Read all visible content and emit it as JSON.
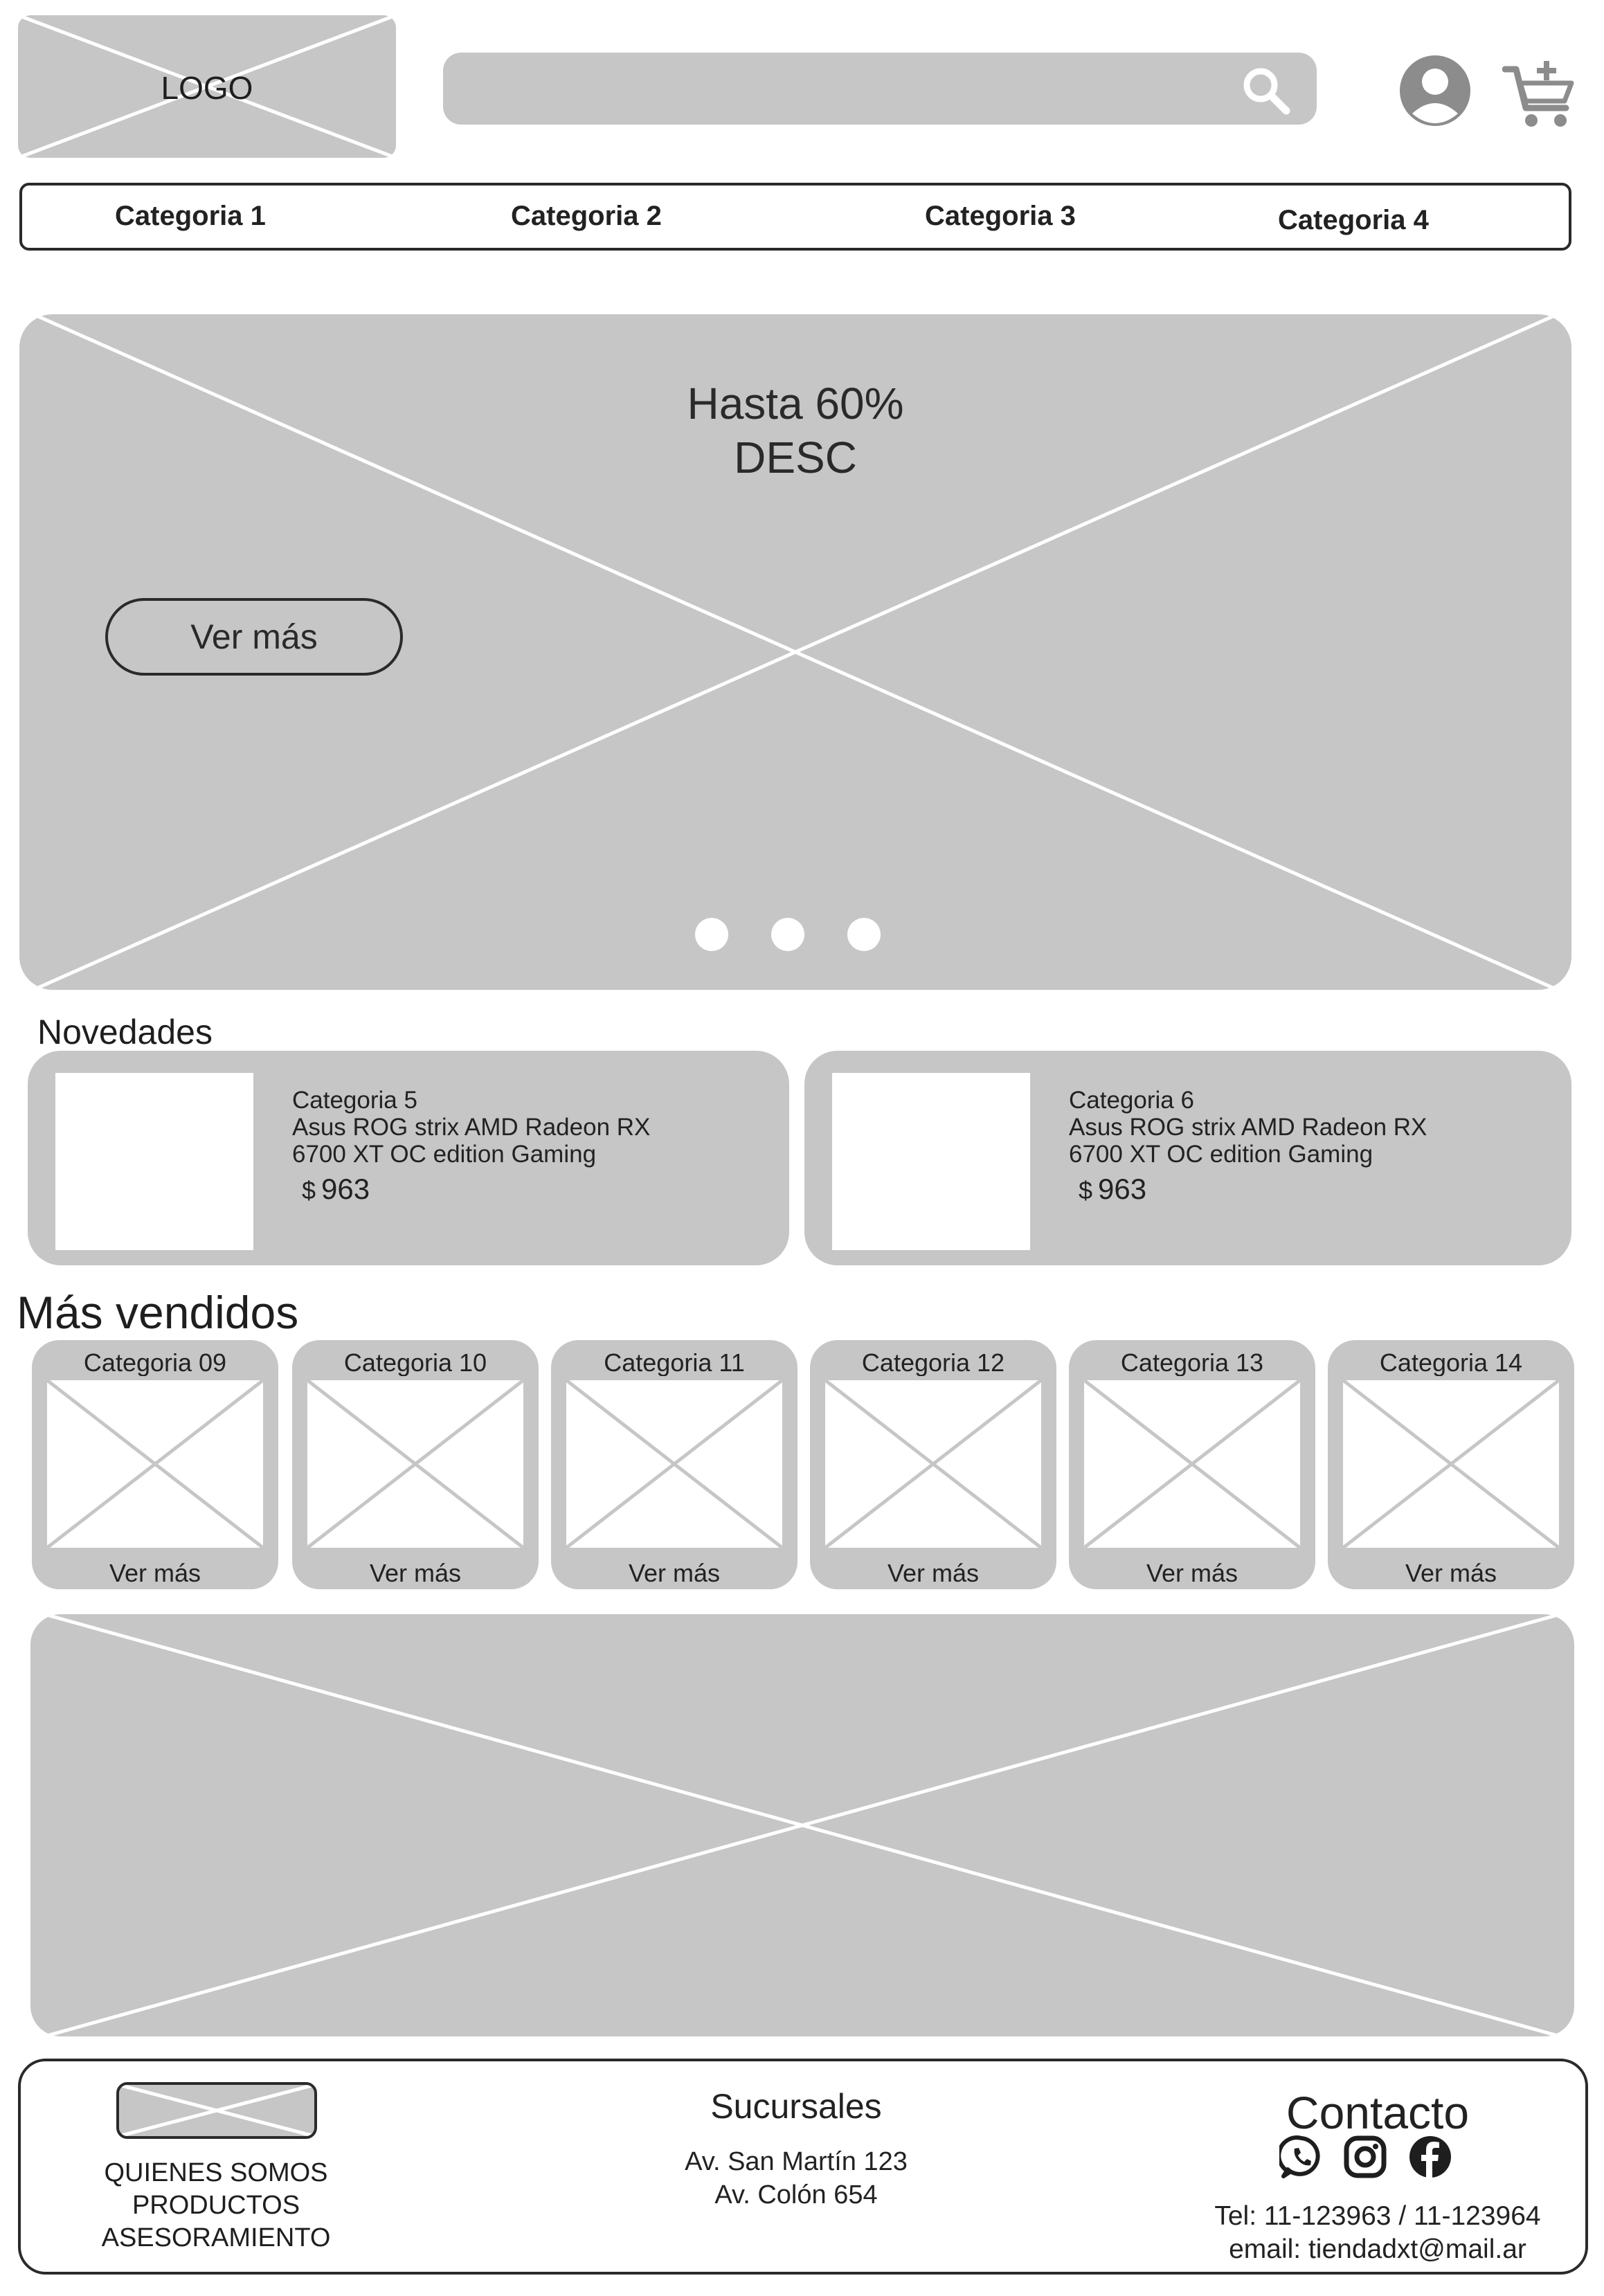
{
  "header": {
    "logo_text": "LOGO",
    "search": {
      "value": "",
      "icon": "search-icon"
    },
    "user_icon": "user-icon",
    "cart_icon": "cart-add-icon"
  },
  "nav": {
    "items": [
      {
        "label": "Categoria 1"
      },
      {
        "label": "Categoria 2"
      },
      {
        "label": "Categoria 3"
      },
      {
        "label": "Categoria 4"
      }
    ]
  },
  "hero": {
    "title_line1": "Hasta 60%",
    "title_line2": "DESC",
    "button_label": "Ver más",
    "slides": 3
  },
  "novedades": {
    "title": "Novedades",
    "items": [
      {
        "category": "Categoria 5",
        "name_line1": "Asus ROG strix AMD Radeon RX",
        "name_line2": "6700 XT OC edition Gaming",
        "currency": "$",
        "price": "963"
      },
      {
        "category": "Categoria 6",
        "name_line1": "Asus ROG strix AMD Radeon RX",
        "name_line2": "6700 XT OC edition Gaming",
        "currency": "$",
        "price": "963"
      }
    ]
  },
  "mas_vendidos": {
    "title": "Más vendidos",
    "items": [
      {
        "category": "Categoria 09",
        "link": "Ver más"
      },
      {
        "category": "Categoria 10",
        "link": "Ver más"
      },
      {
        "category": "Categoria 11",
        "link": "Ver más"
      },
      {
        "category": "Categoria 12",
        "link": "Ver más"
      },
      {
        "category": "Categoria 13",
        "link": "Ver más"
      },
      {
        "category": "Categoria 14",
        "link": "Ver más"
      }
    ]
  },
  "footer": {
    "links": [
      "QUIENES SOMOS",
      "PRODUCTOS",
      "ASESORAMIENTO"
    ],
    "sucursales_title": "Sucursales",
    "sucursales": [
      "Av. San Martín 123",
      "Av. Colón 654"
    ],
    "contact_title": "Contacto",
    "social_icons": [
      "whatsapp-icon",
      "instagram-icon",
      "facebook-icon"
    ],
    "phone": "Tel: 11-123963 / 11-123964",
    "email": "email: tiendadxt@mail.ar"
  },
  "colors": {
    "placeholder_gray": "#c6c6c6",
    "text": "#1e1e1e",
    "icon_gray": "#8c8c8c",
    "border": "#2a2a2a"
  }
}
